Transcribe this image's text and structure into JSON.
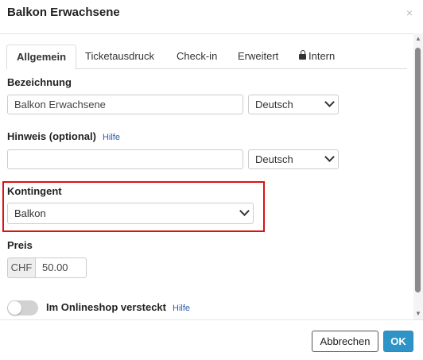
{
  "dialog": {
    "title": "Balkon Erwachsene",
    "close_symbol": "×"
  },
  "tabs": [
    {
      "label": "Allgemein",
      "active": true
    },
    {
      "label": "Ticketausdruck",
      "active": false
    },
    {
      "label": "Check-in",
      "active": false
    },
    {
      "label": "Erweitert",
      "active": false
    },
    {
      "label": "Intern",
      "active": false,
      "icon": "lock-icon"
    }
  ],
  "form": {
    "bezeichnung": {
      "label": "Bezeichnung",
      "value": "Balkon Erwachsene",
      "language": "Deutsch"
    },
    "hinweis": {
      "label": "Hinweis (optional)",
      "help": "Hilfe",
      "value": "",
      "language": "Deutsch"
    },
    "kontingent": {
      "label": "Kontingent",
      "value": "Balkon"
    },
    "preis": {
      "label": "Preis",
      "currency": "CHF",
      "value": "50.00"
    },
    "onlineshop": {
      "label": "Im Onlineshop versteckt",
      "help": "Hilfe",
      "checked": false
    }
  },
  "footer": {
    "cancel_label": "Abbrechen",
    "ok_label": "OK"
  },
  "colors": {
    "accent": "#2e93c6",
    "highlight": "#e01010",
    "link": "#2a5db0"
  }
}
